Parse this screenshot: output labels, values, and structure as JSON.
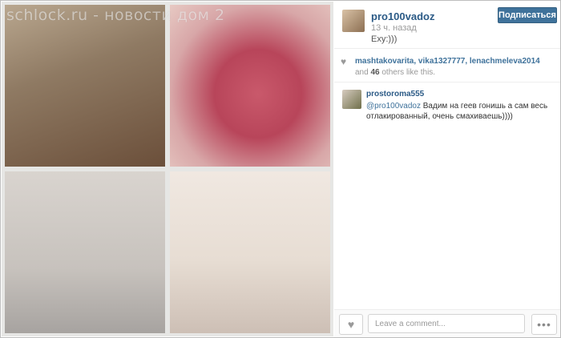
{
  "watermark": "schlock.ru - новости дом 2",
  "post": {
    "username": "pro100vadoz",
    "time": "13 ч. назад",
    "caption": "Exy:)))",
    "follow_label": "Подписаться"
  },
  "likes": {
    "names": "mashtakovarita, vika1327777, lenachmeleva2014",
    "and_text": " and ",
    "count": "46",
    "suffix": " others like this."
  },
  "comment": {
    "username": "prostoroma555",
    "mention": "@pro100vadoz",
    "text": " Вадим на геев гонишь а сам весь отлакированный, очень смахиваешь))))"
  },
  "footer": {
    "comment_placeholder": "Leave a comment...",
    "more_label": "•••"
  },
  "icons": {
    "heart": "heart-icon",
    "more": "ellipsis-icon"
  }
}
